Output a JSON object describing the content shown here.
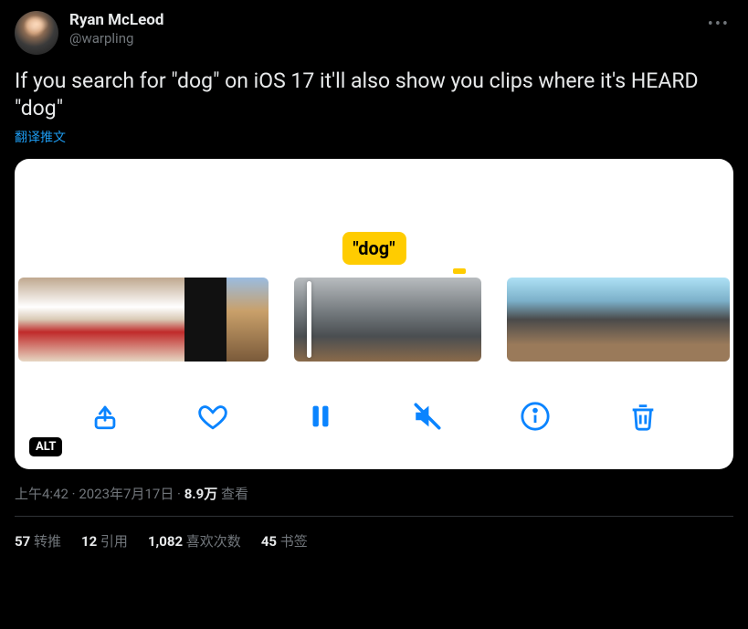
{
  "author": {
    "display_name": "Ryan McLeod",
    "handle": "@warpling"
  },
  "tweet_text": "If you search for \"dog\" on iOS 17 it'll also show you clips where it's HEARD \"dog\"",
  "translate_label": "翻译推文",
  "media": {
    "search_label": "\"dog\"",
    "alt_badge": "ALT"
  },
  "meta": {
    "time": "上午4:42",
    "date": "2023年7月17日",
    "views_count": "8.9万",
    "views_label": "查看"
  },
  "stats": {
    "retweets": {
      "count": "57",
      "label": "转推"
    },
    "quotes": {
      "count": "12",
      "label": "引用"
    },
    "likes": {
      "count": "1,082",
      "label": "喜欢次数"
    },
    "bookmarks": {
      "count": "45",
      "label": "书签"
    }
  }
}
